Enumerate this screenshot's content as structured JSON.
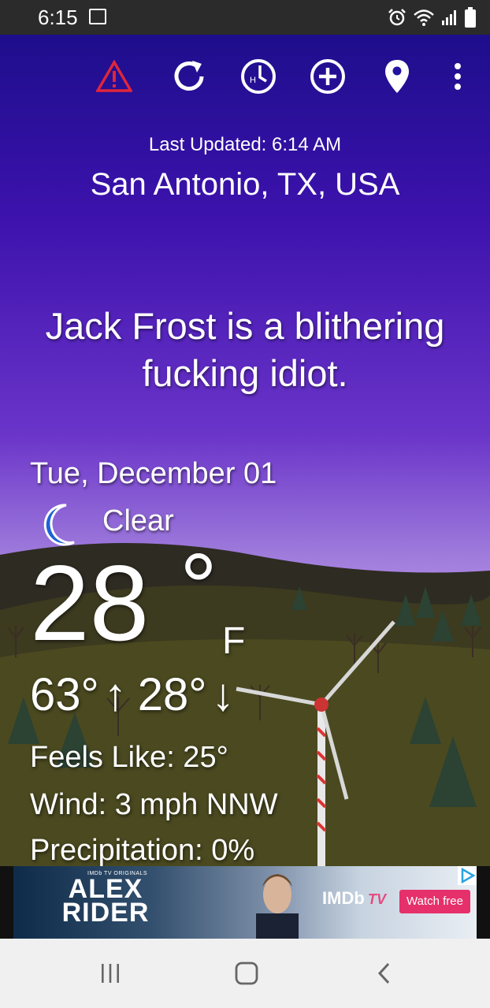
{
  "status_bar": {
    "time": "6:15",
    "icons": [
      "gallery-icon",
      "alarm-icon",
      "wifi-icon",
      "signal-icon",
      "battery-icon"
    ]
  },
  "toolbar": {
    "icons": [
      "alert-icon",
      "refresh-icon",
      "history-icon",
      "add-location-icon",
      "location-pin-icon",
      "overflow-menu-icon"
    ],
    "alert_color": "#e0263a"
  },
  "weather": {
    "last_updated": "Last Updated: 6:14 AM",
    "location": "San Antonio, TX, USA",
    "headline": "Jack Frost is a blithering fucking idiot.",
    "date": "Tue, December 01",
    "condition": "Clear",
    "condition_icon": "moon-icon",
    "temperature": "28",
    "degree_symbol": "°",
    "unit": "F",
    "high": "63°",
    "high_arrow": "↑",
    "low": "28°",
    "low_arrow": "↓",
    "feels_like": "Feels Like: 25°",
    "wind": "Wind: 3 mph NNW",
    "precipitation": "Precipitation: 0%"
  },
  "ad": {
    "series_label": "IMDb TV ORIGINALS",
    "title_line1": "ALEX",
    "title_line2": "RIDER",
    "brand": "IMDb",
    "brand_suffix": "TV",
    "cta": "Watch free"
  },
  "nav_bar": {
    "buttons": [
      "recents-icon",
      "home-icon",
      "back-icon"
    ]
  },
  "colors": {
    "sky_top": "#1d0e8c",
    "sky_mid": "#6a34c9",
    "sky_horizon": "#b893e8",
    "moon": "#1e63d6",
    "cta": "#e6306b"
  }
}
